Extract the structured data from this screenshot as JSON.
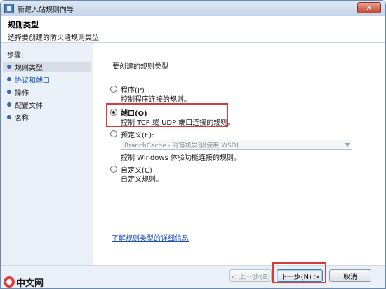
{
  "window": {
    "title": "新建入站规则向导",
    "close_label": "✕"
  },
  "header": {
    "title": "规则类型",
    "subtitle": "选择要创建的防火墙规则类型"
  },
  "steps": {
    "title": "步骤:",
    "items": [
      {
        "label": "规则类型",
        "state": "current"
      },
      {
        "label": "协议和端口",
        "state": "link"
      },
      {
        "label": "操作",
        "state": "normal"
      },
      {
        "label": "配置文件",
        "state": "normal"
      },
      {
        "label": "名称",
        "state": "normal"
      }
    ]
  },
  "content": {
    "prompt": "要创建的规则类型",
    "options": [
      {
        "label": "程序(P)",
        "desc": "控制程序连接的规则。",
        "checked": false
      },
      {
        "label": "端口(O)",
        "desc": "控制 TCP 或 UDP 端口连接的规则。",
        "checked": true
      },
      {
        "label": "预定义(E):",
        "desc": "控制 Windows 体验功能连接的规则。",
        "checked": false
      },
      {
        "label": "自定义(C)",
        "desc": "自定义规则。",
        "checked": false
      }
    ],
    "predefined_select": {
      "value": "BranchCache - 对等机发现(使用 WSD)"
    },
    "learn_more": "了解规则类型的详细信息"
  },
  "footer": {
    "back": "< 上一步(B)",
    "next": "下一步(N) >",
    "cancel": "取消"
  },
  "watermark": {
    "text": "中文网"
  },
  "colors": {
    "highlight": "#d83a3a",
    "link": "#1d4fb0",
    "title_close": "#c4462d"
  }
}
